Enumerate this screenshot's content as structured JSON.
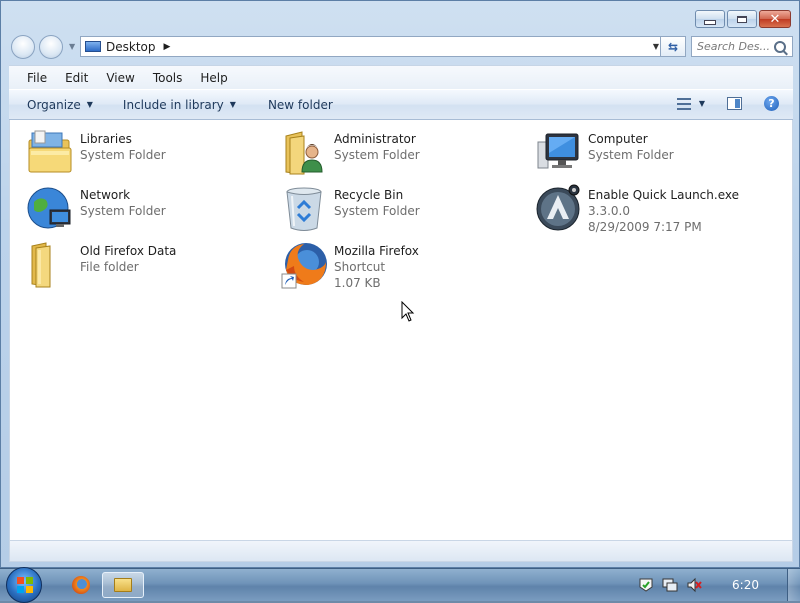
{
  "window": {
    "controls": {
      "minimize": "minimize",
      "maximize": "maximize",
      "close": "close"
    }
  },
  "nav": {
    "address": "Desktop",
    "address_icon": "desktop-icon",
    "search_placeholder": "Search Des..."
  },
  "menu": {
    "items": [
      "File",
      "Edit",
      "View",
      "Tools",
      "Help"
    ]
  },
  "commands": {
    "organize": "Organize",
    "include": "Include in library",
    "new_folder": "New folder"
  },
  "items": [
    {
      "name": "Libraries",
      "sub1": "System Folder",
      "sub2": "",
      "icon": "libraries-icon"
    },
    {
      "name": "Administrator",
      "sub1": "System Folder",
      "sub2": "",
      "icon": "user-folder-icon"
    },
    {
      "name": "Computer",
      "sub1": "System Folder",
      "sub2": "",
      "icon": "computer-icon"
    },
    {
      "name": "Network",
      "sub1": "System Folder",
      "sub2": "",
      "icon": "network-icon"
    },
    {
      "name": "Recycle Bin",
      "sub1": "System Folder",
      "sub2": "",
      "icon": "recycle-bin-icon"
    },
    {
      "name": "Enable Quick Launch.exe",
      "sub1": "3.3.0.0",
      "sub2": "8/29/2009 7:17 PM",
      "icon": "app-icon"
    },
    {
      "name": "Old Firefox Data",
      "sub1": "File folder",
      "sub2": "",
      "icon": "folder-icon"
    },
    {
      "name": "Mozilla Firefox",
      "sub1": "Shortcut",
      "sub2": "1.07 KB",
      "icon": "firefox-shortcut-icon"
    }
  ],
  "taskbar": {
    "clock": "6:20",
    "pinned": [
      "firefox-icon",
      "explorer-icon"
    ],
    "tray": [
      "action-center-icon",
      "network-icon",
      "volume-muted-icon"
    ]
  },
  "colors": {
    "window_frame": "#bcd3eb",
    "taskbar": "#6f93b8",
    "secondary_text": "#6d6d6d"
  }
}
